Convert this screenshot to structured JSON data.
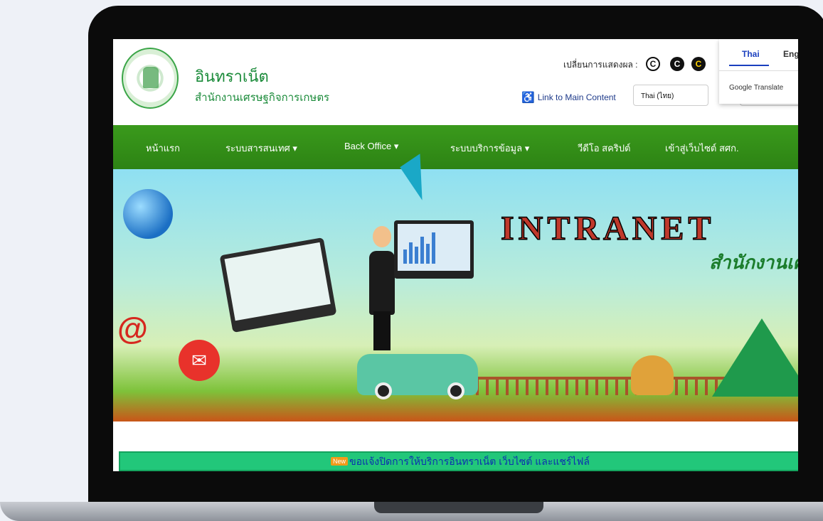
{
  "header": {
    "site_title": "อินทราเน็ต",
    "site_subtitle": "สำนักงานเศรษฐกิจการเกษตร",
    "display_mode_label": "เปลี่ยนการแสดงผล :",
    "contrast_buttons": [
      "C",
      "C",
      "C"
    ],
    "accessibility_link": "Link to Main Content",
    "language_select_value": "Thai (ไทย)"
  },
  "translate_panel": {
    "tab_thai": "Thai",
    "tab_english": "Engl",
    "brand": "Google Translate"
  },
  "nav": {
    "items": [
      {
        "label": "หน้าแรก"
      },
      {
        "label": "ระบบสารสนเทศ ▾"
      },
      {
        "label": "Back Office ▾"
      },
      {
        "label": "ระบบบริการข้อมูล ▾"
      },
      {
        "label": "วีดีโอ สคริปต์"
      },
      {
        "label": "เข้าสู่เว็บไซต์ สศก."
      }
    ]
  },
  "banner": {
    "title": "INTRANET",
    "subtitle": "สำนักงานเศ"
  },
  "ticker": {
    "badge": "New",
    "text": "ขอแจ้งปิดการให้บริการอินทราเน็ต เว็บไซต์ และแชร์ไฟล์"
  },
  "colors": {
    "brand_green": "#2d8314",
    "ticker_green": "#22c77a",
    "cursor": "#1aa8c7"
  }
}
